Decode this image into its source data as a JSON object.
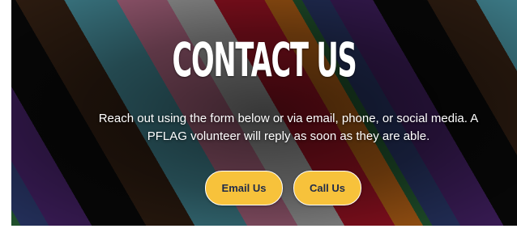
{
  "hero": {
    "title": "CONTACT US",
    "description": "Reach out using the form below or via email, phone, or social media. A PFLAG volunteer will reply as soon as they are able.",
    "buttons": {
      "email_label": "Email Us",
      "call_label": "Call Us"
    },
    "colors": {
      "button_bg": "#f7c23b",
      "button_text": "#1e2a4a",
      "stripes": [
        "#2a6b3a",
        "#2f3f78",
        "#4b2470",
        "#0a0a0a",
        "#3a2415",
        "#4fa0b0",
        "#cf7a9b",
        "#c8c8c8",
        "#c0162b",
        "#d8741a"
      ]
    }
  }
}
